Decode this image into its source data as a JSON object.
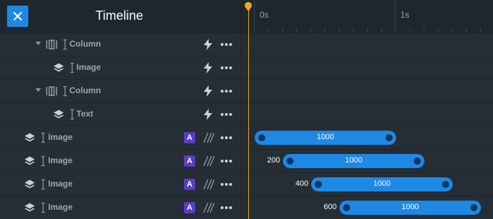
{
  "header": {
    "title": "Timeline",
    "close_label": "close"
  },
  "ruler": {
    "labels": [
      "0s",
      "1s"
    ]
  },
  "rows": [
    {
      "label": "Column",
      "type": "column"
    },
    {
      "label": "Image",
      "type": "image"
    },
    {
      "label": "Column",
      "type": "column"
    },
    {
      "label": "Text",
      "type": "text"
    },
    {
      "label": "Image",
      "type": "image",
      "badge": "A",
      "duration": "1000"
    },
    {
      "label": "Image",
      "type": "image",
      "badge": "A",
      "delay": "200",
      "duration": "1000"
    },
    {
      "label": "Image",
      "type": "image",
      "badge": "A",
      "delay": "400",
      "duration": "1000"
    },
    {
      "label": "Image",
      "type": "image",
      "badge": "A",
      "delay": "600",
      "duration": "1000"
    }
  ],
  "colors": {
    "accent": "#1e88e5",
    "playhead": "#f1a524",
    "badge": "#5c3cc4"
  }
}
